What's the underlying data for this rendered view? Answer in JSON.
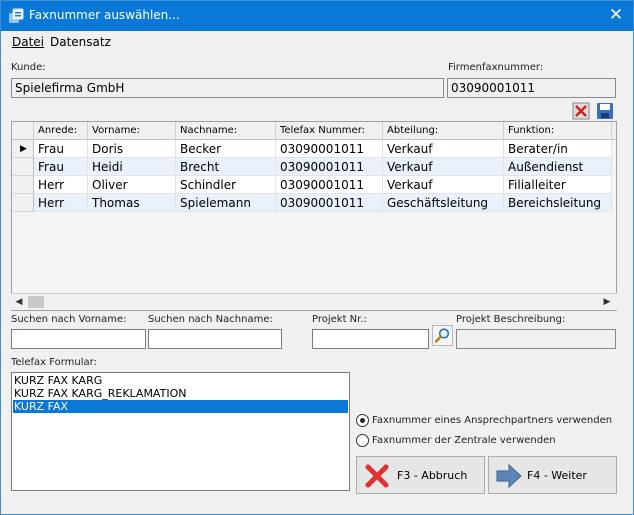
{
  "window": {
    "title": "Faxnummer auswählen..."
  },
  "menu": {
    "items": [
      "Datei",
      "Datensatz"
    ]
  },
  "kunde": {
    "label": "Kunde:",
    "value": "Spielefirma GmbH"
  },
  "firmenfax": {
    "label": "Firmenfaxnummer:",
    "value": "03090001011"
  },
  "grid": {
    "columns": [
      "Anrede:",
      "Vorname:",
      "Nachname:",
      "Telefax Nummer:",
      "Abteilung:",
      "Funktion:"
    ],
    "rows": [
      [
        "Frau",
        "Doris",
        "Becker",
        "03090001011",
        "Verkauf",
        "Berater/in"
      ],
      [
        "Frau",
        "Heidi",
        "Brecht",
        "03090001011",
        "Verkauf",
        "Außendienst"
      ],
      [
        "Herr",
        "Oliver",
        "Schindler",
        "03090001011",
        "Verkauf",
        "Filialleiter"
      ],
      [
        "Herr",
        "Thomas",
        "Spielemann",
        "03090001011",
        "Geschäftsleitung",
        "Bereichsleitung"
      ]
    ],
    "current_row": 0
  },
  "search": {
    "vorname_label": "Suchen nach Vorname:",
    "nachname_label": "Suchen nach Nachname:",
    "projekt_label": "Projekt Nr.:",
    "beschreibung_label": "Projekt Beschreibung:",
    "vorname_value": "",
    "nachname_value": "",
    "projekt_value": "",
    "beschreibung_value": ""
  },
  "telefax": {
    "label": "Telefax Formular:",
    "items": [
      "KURZ FAX  KARG",
      "KURZ FAX  KARG_REKLAMATION",
      "KURZ FAX"
    ],
    "selected": 2
  },
  "options": {
    "ansprechpartner": "Faxnummer eines Ansprechpartners verwenden",
    "zentrale": "Faxnummer der Zentrale verwenden",
    "selected": "ansprechpartner"
  },
  "buttons": {
    "abbruch": "F3 - Abbruch",
    "weiter": "F4 - Weiter"
  },
  "colors": {
    "titlebar": "#0a78d7",
    "selection": "#0a78d7",
    "cancel_icon": "#e03030",
    "arrow_icon": "#5b84b8"
  }
}
